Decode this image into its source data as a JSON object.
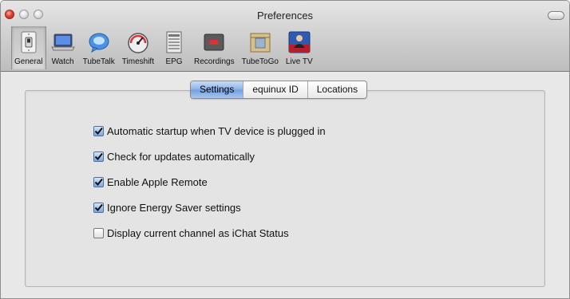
{
  "window": {
    "title": "Preferences"
  },
  "toolbar": {
    "items": [
      {
        "label": "General",
        "icon": "switch-icon",
        "selected": true
      },
      {
        "label": "Watch",
        "icon": "laptop-icon",
        "selected": false
      },
      {
        "label": "TubeTalk",
        "icon": "chat-bubble-icon",
        "selected": false
      },
      {
        "label": "Timeshift",
        "icon": "gauge-icon",
        "selected": false
      },
      {
        "label": "EPG",
        "icon": "guide-list-icon",
        "selected": false
      },
      {
        "label": "Recordings",
        "icon": "record-icon",
        "selected": false
      },
      {
        "label": "TubeToGo",
        "icon": "box-icon",
        "selected": false
      },
      {
        "label": "Live TV",
        "icon": "presenter-icon",
        "selected": false
      }
    ]
  },
  "tabs": [
    {
      "label": "Settings",
      "active": true
    },
    {
      "label": "equinux ID",
      "active": false
    },
    {
      "label": "Locations",
      "active": false
    }
  ],
  "options": [
    {
      "label": "Automatic startup when TV device is plugged in",
      "checked": true
    },
    {
      "label": "Check for updates automatically",
      "checked": true
    },
    {
      "label": "Enable Apple Remote",
      "checked": true
    },
    {
      "label": "Ignore Energy Saver settings",
      "checked": true
    },
    {
      "label": "Display current channel as iChat Status",
      "checked": false
    }
  ],
  "colors": {
    "accent": "#6f9ee0",
    "close_button": "#e2402f"
  }
}
